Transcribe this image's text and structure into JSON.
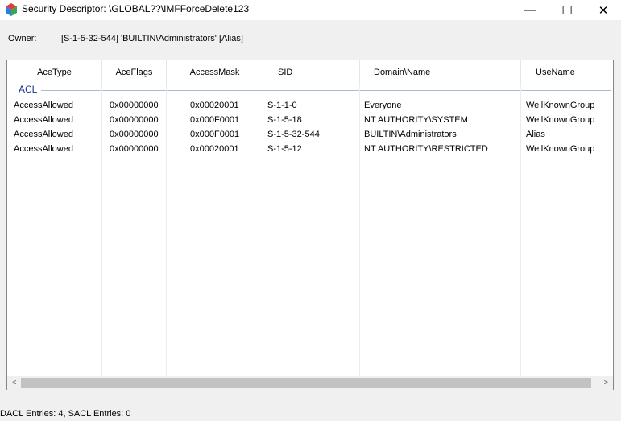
{
  "window": {
    "title": "Security Descriptor: \\GLOBAL??\\IMFForceDelete123",
    "min_symbol": "—",
    "max_symbol": "☐",
    "close_symbol": "✕"
  },
  "owner": {
    "label": "Owner:",
    "value": "[S-1-5-32-544] 'BUILTIN\\Administrators' [Alias]"
  },
  "acl_list": {
    "columns": [
      "AceType",
      "AceFlags",
      "AccessMask",
      "SID",
      "Domain\\Name",
      "UseName"
    ],
    "group_label": "ACL",
    "rows": [
      [
        "AccessAllowed",
        "0x00000000",
        "0x00020001",
        "S-1-1-0",
        "Everyone",
        "WellKnownGroup"
      ],
      [
        "AccessAllowed",
        "0x00000000",
        "0x000F0001",
        "S-1-5-18",
        "NT AUTHORITY\\SYSTEM",
        "WellKnownGroup"
      ],
      [
        "AccessAllowed",
        "0x00000000",
        "0x000F0001",
        "S-1-5-32-544",
        "BUILTIN\\Administrators",
        "Alias"
      ],
      [
        "AccessAllowed",
        "0x00000000",
        "0x00020001",
        "S-1-5-12",
        "NT AUTHORITY\\RESTRICTED",
        "WellKnownGroup"
      ]
    ]
  },
  "scrollbar": {
    "left_arrow": "<",
    "right_arrow": ">"
  },
  "status": {
    "text": "DACL Entries: 4, SACL Entries: 0"
  },
  "colors": {
    "group_header": "#1e3287",
    "title_bar": "#ffffff",
    "window_bg": "#f0f0f0"
  }
}
